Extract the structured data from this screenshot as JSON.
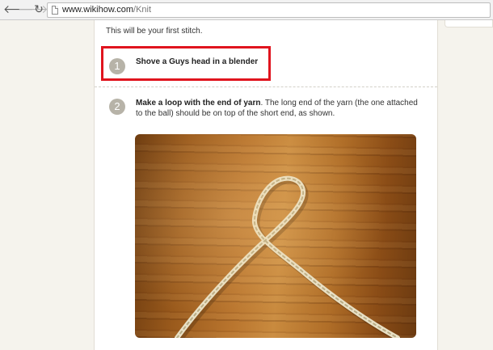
{
  "browser": {
    "back_glyph": "🡐",
    "forward_glyph": "🡒",
    "reload_glyph": "↻",
    "url_host": "www.wikihow.com",
    "url_path": "/Knit"
  },
  "article": {
    "intro_text": "This will be your first stitch.",
    "steps": [
      {
        "number": "1",
        "text": "Shove a Guys head in a blender"
      },
      {
        "number": "2",
        "bold_text": "Make a loop with the end of yarn",
        "text": ". The long end of the yarn (the one attached to the ball) should be on top of the short end, as shown."
      }
    ]
  },
  "colors": {
    "highlight": "#e0141e",
    "step_badge": "#b7b3a8"
  }
}
